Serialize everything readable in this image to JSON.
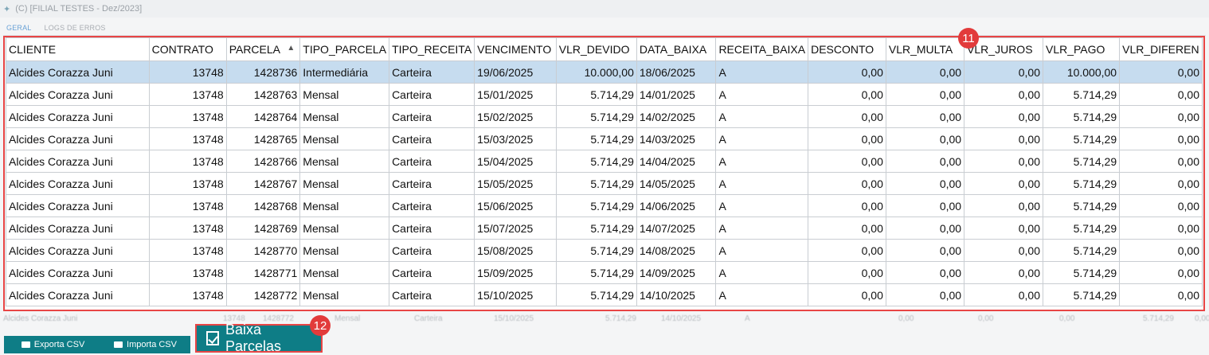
{
  "window": {
    "title": "(C)  [FILIAL TESTES - Dez/2023]"
  },
  "tabs": [
    {
      "label": "GERAL",
      "active": true
    },
    {
      "label": "LOGS DE ERROS",
      "active": false
    }
  ],
  "table": {
    "sorted_column": "PARCELA",
    "columns": [
      "CLIENTE",
      "CONTRATO",
      "PARCELA",
      "TIPO_PARCELA",
      "TIPO_RECEITA",
      "VENCIMENTO",
      "VLR_DEVIDO",
      "DATA_BAIXA",
      "RECEITA_BAIXA",
      "DESCONTO",
      "VLR_MULTA",
      "VLR_JUROS",
      "VLR_PAGO",
      "VLR_DIFEREN"
    ],
    "rows": [
      [
        "Alcides Corazza Juni",
        "13748",
        "1428736",
        "Intermediária",
        "Carteira",
        "19/06/2025",
        "10.000,00",
        "18/06/2025",
        "A",
        "0,00",
        "0,00",
        "0,00",
        "10.000,00",
        "0,00"
      ],
      [
        "Alcides Corazza Juni",
        "13748",
        "1428763",
        "Mensal",
        "Carteira",
        "15/01/2025",
        "5.714,29",
        "14/01/2025",
        "A",
        "0,00",
        "0,00",
        "0,00",
        "5.714,29",
        "0,00"
      ],
      [
        "Alcides Corazza Juni",
        "13748",
        "1428764",
        "Mensal",
        "Carteira",
        "15/02/2025",
        "5.714,29",
        "14/02/2025",
        "A",
        "0,00",
        "0,00",
        "0,00",
        "5.714,29",
        "0,00"
      ],
      [
        "Alcides Corazza Juni",
        "13748",
        "1428765",
        "Mensal",
        "Carteira",
        "15/03/2025",
        "5.714,29",
        "14/03/2025",
        "A",
        "0,00",
        "0,00",
        "0,00",
        "5.714,29",
        "0,00"
      ],
      [
        "Alcides Corazza Juni",
        "13748",
        "1428766",
        "Mensal",
        "Carteira",
        "15/04/2025",
        "5.714,29",
        "14/04/2025",
        "A",
        "0,00",
        "0,00",
        "0,00",
        "5.714,29",
        "0,00"
      ],
      [
        "Alcides Corazza Juni",
        "13748",
        "1428767",
        "Mensal",
        "Carteira",
        "15/05/2025",
        "5.714,29",
        "14/05/2025",
        "A",
        "0,00",
        "0,00",
        "0,00",
        "5.714,29",
        "0,00"
      ],
      [
        "Alcides Corazza Juni",
        "13748",
        "1428768",
        "Mensal",
        "Carteira",
        "15/06/2025",
        "5.714,29",
        "14/06/2025",
        "A",
        "0,00",
        "0,00",
        "0,00",
        "5.714,29",
        "0,00"
      ],
      [
        "Alcides Corazza Juni",
        "13748",
        "1428769",
        "Mensal",
        "Carteira",
        "15/07/2025",
        "5.714,29",
        "14/07/2025",
        "A",
        "0,00",
        "0,00",
        "0,00",
        "5.714,29",
        "0,00"
      ],
      [
        "Alcides Corazza Juni",
        "13748",
        "1428770",
        "Mensal",
        "Carteira",
        "15/08/2025",
        "5.714,29",
        "14/08/2025",
        "A",
        "0,00",
        "0,00",
        "0,00",
        "5.714,29",
        "0,00"
      ],
      [
        "Alcides Corazza Juni",
        "13748",
        "1428771",
        "Mensal",
        "Carteira",
        "15/09/2025",
        "5.714,29",
        "14/09/2025",
        "A",
        "0,00",
        "0,00",
        "0,00",
        "5.714,29",
        "0,00"
      ],
      [
        "Alcides Corazza Juni",
        "13748",
        "1428772",
        "Mensal",
        "Carteira",
        "15/10/2025",
        "5.714,29",
        "14/10/2025",
        "A",
        "0,00",
        "0,00",
        "0,00",
        "5.714,29",
        "0,00"
      ]
    ],
    "ghost_row": [
      "Alcides Corazza Juni",
      "13748",
      "1428772",
      "Mensal",
      "Carteira",
      "15/10/2025",
      "5.714,29",
      "14/10/2025",
      "A",
      "0,00",
      "0,00",
      "0,00",
      "5.714,29",
      "0,00"
    ]
  },
  "callouts": {
    "grid": "11",
    "baixa_button": "12"
  },
  "buttons": {
    "exporta_csv": "Exporta CSV",
    "importa_csv": "Importa CSV",
    "baixa_parcelas": "Baixa Parcelas"
  },
  "colors": {
    "accent": "#0e7d86",
    "callout": "#e23b3b",
    "selected_row": "#c6dcef"
  }
}
